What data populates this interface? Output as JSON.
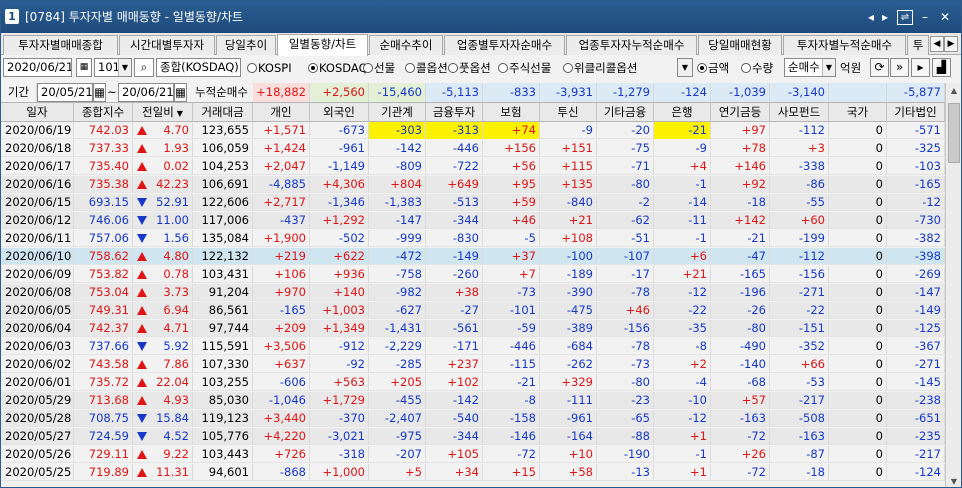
{
  "window": {
    "number": "1",
    "title": "[0784] 투자자별 매매동향 - 일별동향/차트"
  },
  "tabs": [
    "투자자별매매종합",
    "시간대별투자자",
    "당일추이",
    "일별동향/차트",
    "순매수추이",
    "업종별투자자순매수",
    "업종투자자누적순매수",
    "당일매매현황",
    "투자자별누적순매수",
    "투"
  ],
  "active_tab": 3,
  "controls": {
    "date": "2020/06/21",
    "code": "101",
    "market": "종합(KOSDAQ)",
    "radios": [
      "KOSPI",
      "KOSDAQ",
      "선물",
      "콜옵션",
      "풋옵션",
      "주식선물",
      "위클리콜옵션"
    ],
    "radio_selected": "KOSDAQ",
    "unit_radios": [
      "금액",
      "수량"
    ],
    "unit_selected": "금액",
    "trade_type": "순매수",
    "unit_label": "억원"
  },
  "period": {
    "label": "기간",
    "from": "20/05/21",
    "tilde": "~",
    "to": "20/06/21",
    "cum_label": "누적순매수",
    "cum_values": [
      "+18,882",
      "+2,560",
      "-15,460",
      "-5,113",
      "-833",
      "-3,931",
      "-1,279",
      "-124",
      "-1,039",
      "-3,140",
      "",
      "-5,877"
    ]
  },
  "columns": [
    "일자",
    "종합지수",
    "전일비",
    "거래대금",
    "개인",
    "외국인",
    "기관계",
    "금융투자",
    "보험",
    "투신",
    "기타금융",
    "은행",
    "연기금등",
    "사모펀드",
    "국가",
    "기타법인"
  ],
  "rows": [
    [
      "2020/06/19",
      "742.03",
      "up",
      "4.70",
      "123,655",
      "+1,571",
      "-673",
      "-303",
      "-313",
      "+74",
      "-9",
      "-20",
      "-21",
      "+97",
      "-112",
      "0",
      "-571"
    ],
    [
      "2020/06/18",
      "737.33",
      "up",
      "1.93",
      "106,059",
      "+1,424",
      "-961",
      "-142",
      "-446",
      "+156",
      "+151",
      "-75",
      "-9",
      "+78",
      "+3",
      "0",
      "-325"
    ],
    [
      "2020/06/17",
      "735.40",
      "up",
      "0.02",
      "104,253",
      "+2,047",
      "-1,149",
      "-809",
      "-722",
      "+56",
      "+115",
      "-71",
      "+4",
      "+146",
      "-338",
      "0",
      "-103"
    ],
    [
      "2020/06/16",
      "735.38",
      "up",
      "42.23",
      "106,691",
      "-4,885",
      "+4,306",
      "+804",
      "+649",
      "+95",
      "+135",
      "-80",
      "-1",
      "+92",
      "-86",
      "0",
      "-165"
    ],
    [
      "2020/06/15",
      "693.15",
      "dn",
      "52.91",
      "122,606",
      "+2,717",
      "-1,346",
      "-1,383",
      "-513",
      "+59",
      "-840",
      "-2",
      "-14",
      "-18",
      "-55",
      "0",
      "-12"
    ],
    [
      "2020/06/12",
      "746.06",
      "dn",
      "11.00",
      "117,006",
      "-437",
      "+1,292",
      "-147",
      "-344",
      "+46",
      "+21",
      "-62",
      "-11",
      "+142",
      "+60",
      "0",
      "-730"
    ],
    [
      "2020/06/11",
      "757.06",
      "dn",
      "1.56",
      "135,084",
      "+1,900",
      "-502",
      "-999",
      "-830",
      "-5",
      "+108",
      "-51",
      "-1",
      "-21",
      "-199",
      "0",
      "-382"
    ],
    [
      "2020/06/10",
      "758.62",
      "up",
      "4.80",
      "122,132",
      "+219",
      "+622",
      "-472",
      "-149",
      "+37",
      "-100",
      "-107",
      "+6",
      "-47",
      "-112",
      "0",
      "-398"
    ],
    [
      "2020/06/09",
      "753.82",
      "up",
      "0.78",
      "103,431",
      "+106",
      "+936",
      "-758",
      "-260",
      "+7",
      "-189",
      "-17",
      "+21",
      "-165",
      "-156",
      "0",
      "-269"
    ],
    [
      "2020/06/08",
      "753.04",
      "up",
      "3.73",
      "91,204",
      "+970",
      "+140",
      "-982",
      "+38",
      "-73",
      "-390",
      "-78",
      "-12",
      "-196",
      "-271",
      "0",
      "-147"
    ],
    [
      "2020/06/05",
      "749.31",
      "up",
      "6.94",
      "86,561",
      "-165",
      "+1,003",
      "-627",
      "-27",
      "-101",
      "-475",
      "+46",
      "-22",
      "-26",
      "-22",
      "0",
      "-149"
    ],
    [
      "2020/06/04",
      "742.37",
      "up",
      "4.71",
      "97,744",
      "+209",
      "+1,349",
      "-1,431",
      "-561",
      "-59",
      "-389",
      "-156",
      "-35",
      "-80",
      "-151",
      "0",
      "-125"
    ],
    [
      "2020/06/03",
      "737.66",
      "dn",
      "5.92",
      "115,591",
      "+3,506",
      "-912",
      "-2,229",
      "-171",
      "-446",
      "-684",
      "-78",
      "-8",
      "-490",
      "-352",
      "0",
      "-367"
    ],
    [
      "2020/06/02",
      "743.58",
      "up",
      "7.86",
      "107,330",
      "+637",
      "-92",
      "-285",
      "+237",
      "-115",
      "-262",
      "-73",
      "+2",
      "-140",
      "+66",
      "0",
      "-271"
    ],
    [
      "2020/06/01",
      "735.72",
      "up",
      "22.04",
      "103,255",
      "-606",
      "+563",
      "+205",
      "+102",
      "-21",
      "+329",
      "-80",
      "-4",
      "-68",
      "-53",
      "0",
      "-145"
    ],
    [
      "2020/05/29",
      "713.68",
      "up",
      "4.93",
      "85,030",
      "-1,046",
      "+1,729",
      "-455",
      "-142",
      "-8",
      "-111",
      "-23",
      "-10",
      "+57",
      "-217",
      "0",
      "-238"
    ],
    [
      "2020/05/28",
      "708.75",
      "dn",
      "15.84",
      "119,123",
      "+3,440",
      "-370",
      "-2,407",
      "-540",
      "-158",
      "-961",
      "-65",
      "-12",
      "-163",
      "-508",
      "0",
      "-651"
    ],
    [
      "2020/05/27",
      "724.59",
      "dn",
      "4.52",
      "105,776",
      "+4,220",
      "-3,021",
      "-975",
      "-344",
      "-146",
      "-164",
      "-88",
      "+1",
      "-72",
      "-163",
      "0",
      "-235"
    ],
    [
      "2020/05/26",
      "729.11",
      "up",
      "9.22",
      "103,443",
      "+726",
      "-318",
      "-207",
      "+105",
      "-72",
      "+10",
      "-190",
      "-1",
      "+26",
      "-87",
      "0",
      "-217"
    ],
    [
      "2020/05/25",
      "719.89",
      "up",
      "11.31",
      "94,601",
      "-868",
      "+1,000",
      "+5",
      "+34",
      "+15",
      "+58",
      "-13",
      "+1",
      "-72",
      "-18",
      "0",
      "-124"
    ]
  ],
  "highlights": [
    [
      0,
      6
    ],
    [
      0,
      7
    ],
    [
      0,
      8
    ],
    [
      0,
      11
    ]
  ],
  "selected_row": 7,
  "colors": {
    "up": "#e01414",
    "down": "#1538c8",
    "highlight": "#fff200",
    "selected": "#cfe6f0",
    "title": "#1e4b7c"
  }
}
